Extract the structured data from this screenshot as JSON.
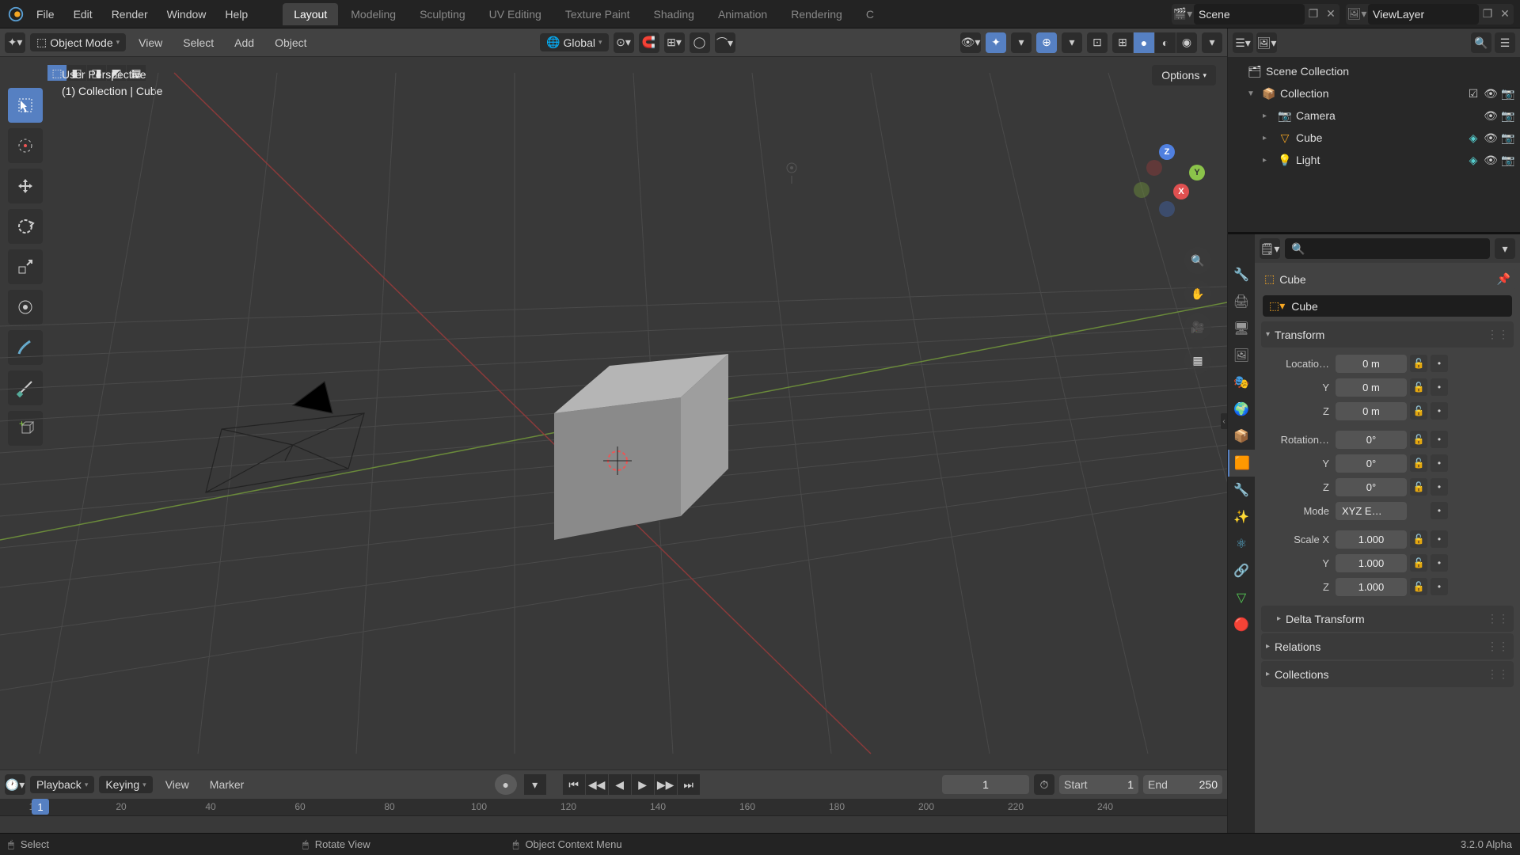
{
  "menus": [
    "File",
    "Edit",
    "Render",
    "Window",
    "Help"
  ],
  "tabs": [
    "Layout",
    "Modeling",
    "Sculpting",
    "UV Editing",
    "Texture Paint",
    "Shading",
    "Animation",
    "Rendering",
    "C"
  ],
  "active_tab": 0,
  "scene_field": {
    "label": "Scene"
  },
  "layer_field": {
    "label": "ViewLayer"
  },
  "vp_header": {
    "mode": "Object Mode",
    "menus": [
      "View",
      "Select",
      "Add",
      "Object"
    ],
    "orientation": "Global",
    "options": "Options"
  },
  "overlay": {
    "line1": "User Perspective",
    "line2": "(1) Collection | Cube"
  },
  "outliner": {
    "root": "Scene Collection",
    "collection": "Collection",
    "items": [
      {
        "icon": "📷",
        "label": "Camera",
        "color": "#f5a623"
      },
      {
        "icon": "▽",
        "label": "Cube",
        "color": "#f5a623"
      },
      {
        "icon": "💡",
        "label": "Light",
        "color": "#f5a623"
      }
    ]
  },
  "properties": {
    "object": "Cube",
    "name": "Cube",
    "panels": {
      "transform": {
        "title": "Transform",
        "loc_label": "Locatio…",
        "loc": [
          "0 m",
          "0 m",
          "0 m"
        ],
        "rot_label": "Rotation…",
        "rot": [
          "0°",
          "0°",
          "0°"
        ],
        "mode_label": "Mode",
        "mode_value": "XYZ E…",
        "scale_label": "Scale X",
        "scale": [
          "1.000",
          "1.000",
          "1.000"
        ],
        "axes": [
          "Y",
          "Z"
        ]
      },
      "delta": "Delta Transform",
      "relations": "Relations",
      "collections": "Collections"
    }
  },
  "timeline": {
    "menus": [
      "Playback",
      "Keying",
      "View",
      "Marker"
    ],
    "current": "1",
    "start_label": "Start",
    "start": "1",
    "end_label": "End",
    "end": "250",
    "ticks": [
      "1",
      "20",
      "40",
      "60",
      "80",
      "100",
      "120",
      "140",
      "160",
      "180",
      "200",
      "220",
      "240"
    ]
  },
  "status": {
    "select": "Select",
    "rotate": "Rotate View",
    "context": "Object Context Menu",
    "version": "3.2.0 Alpha"
  }
}
